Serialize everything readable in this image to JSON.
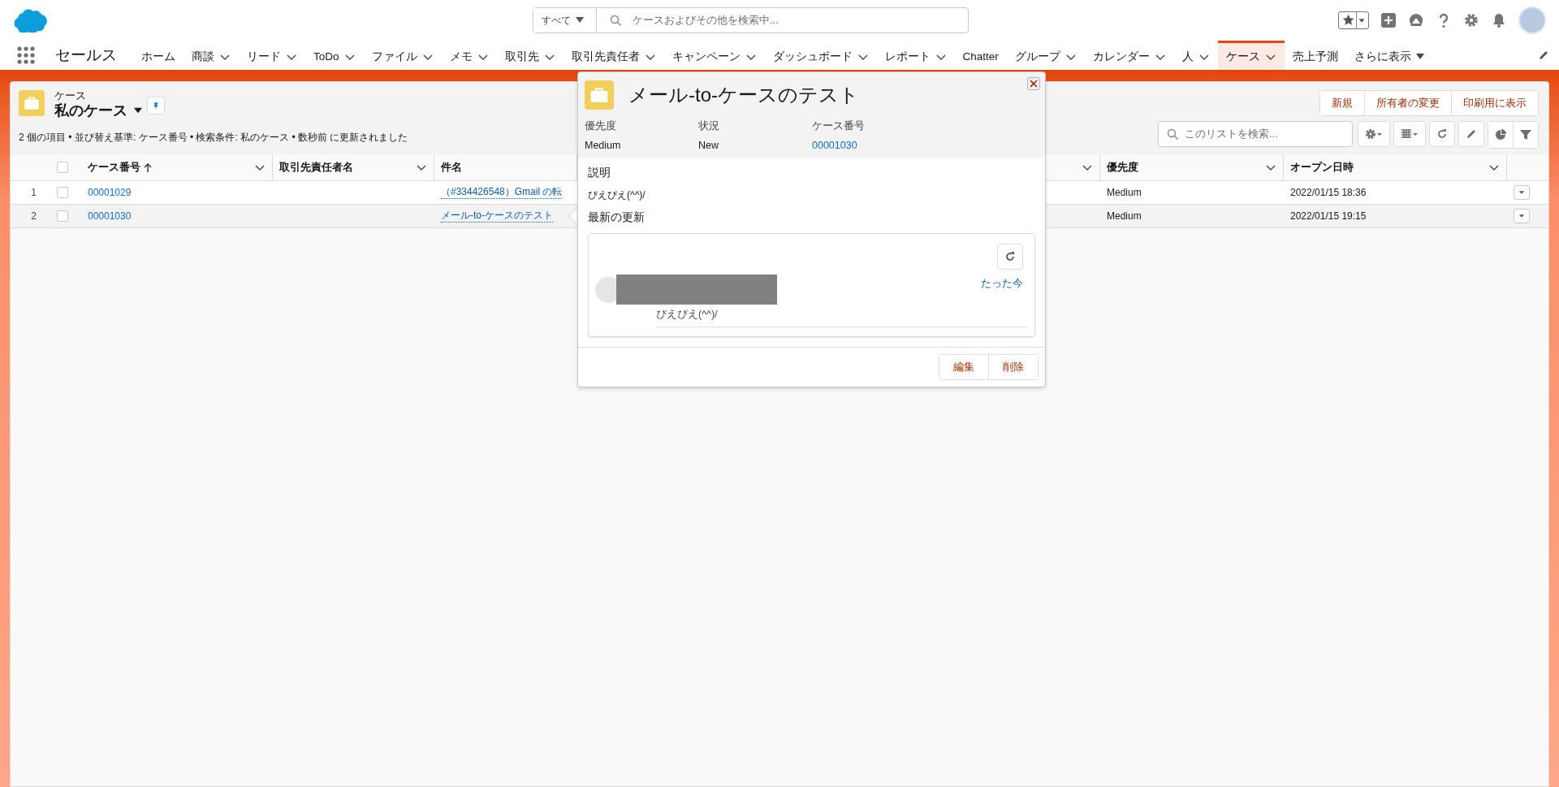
{
  "header": {
    "search_scope": "すべて",
    "search_placeholder": "ケースおよびその他を検索中..."
  },
  "nav": {
    "app_name": "セールス",
    "items": [
      {
        "label": "ホーム",
        "kind": "plain",
        "selected": false
      },
      {
        "label": "商談",
        "kind": "menu",
        "selected": false
      },
      {
        "label": "リード",
        "kind": "menu",
        "selected": false
      },
      {
        "label": "ToDo",
        "kind": "menu",
        "selected": false
      },
      {
        "label": "ファイル",
        "kind": "menu",
        "selected": false
      },
      {
        "label": "メモ",
        "kind": "menu",
        "selected": false
      },
      {
        "label": "取引先",
        "kind": "menu",
        "selected": false
      },
      {
        "label": "取引先責任者",
        "kind": "menu",
        "selected": false
      },
      {
        "label": "キャンペーン",
        "kind": "menu",
        "selected": false
      },
      {
        "label": "ダッシュボード",
        "kind": "menu",
        "selected": false
      },
      {
        "label": "レポート",
        "kind": "menu",
        "selected": false
      },
      {
        "label": "Chatter",
        "kind": "plain",
        "selected": false
      },
      {
        "label": "グループ",
        "kind": "menu",
        "selected": false
      },
      {
        "label": "カレンダー",
        "kind": "menu",
        "selected": false
      },
      {
        "label": "人",
        "kind": "menu",
        "selected": false
      },
      {
        "label": "ケース",
        "kind": "menu",
        "selected": true
      },
      {
        "label": "売上予測",
        "kind": "plain",
        "selected": false
      },
      {
        "label": "さらに表示",
        "kind": "more",
        "selected": false
      }
    ]
  },
  "list_view": {
    "object": "ケース",
    "title": "私のケース",
    "summary": "2 個の項目 • 並び替え基準: ケース番号 • 検索条件: 私のケース • 数秒前 に更新されました",
    "buttons": [
      "新規",
      "所有者の変更",
      "印刷用に表示"
    ],
    "all_selected": false,
    "search_placeholder": "このリストを検索...",
    "columns": [
      {
        "label": "ケース番号",
        "sorted": true
      },
      {
        "label": "取引先責任者名",
        "sorted": false
      },
      {
        "label": "件名",
        "sorted": false
      },
      {
        "label": "優先度",
        "sorted": false
      },
      {
        "label": "オープン日時",
        "sorted": false
      }
    ],
    "rows": [
      {
        "number": "1",
        "checked": false,
        "highlighted": false,
        "case_number": "00001029",
        "subject": "（#334426548）Gmail の転",
        "priority": "Medium",
        "opened": "2022/01/15 18:36"
      },
      {
        "number": "2",
        "checked": false,
        "highlighted": true,
        "case_number": "00001030",
        "subject": "メール-to-ケースのテスト",
        "priority": "Medium",
        "opened": "2022/01/15 19:15"
      }
    ]
  },
  "popup": {
    "title": "メール-to-ケースのテスト",
    "fields": [
      {
        "label": "優先度",
        "value": "Medium",
        "kind": "text"
      },
      {
        "label": "状況",
        "value": "New",
        "kind": "text"
      },
      {
        "label": "ケース番号",
        "value": "00001030",
        "kind": "link"
      }
    ],
    "description_heading": "説明",
    "description": "ぴえぴえ(^^)/",
    "updates_heading": "最新の更新",
    "feed": {
      "time": "たった今",
      "body": "ぴえぴえ(^^)/"
    },
    "buttons": [
      "編集",
      "削除"
    ]
  }
}
